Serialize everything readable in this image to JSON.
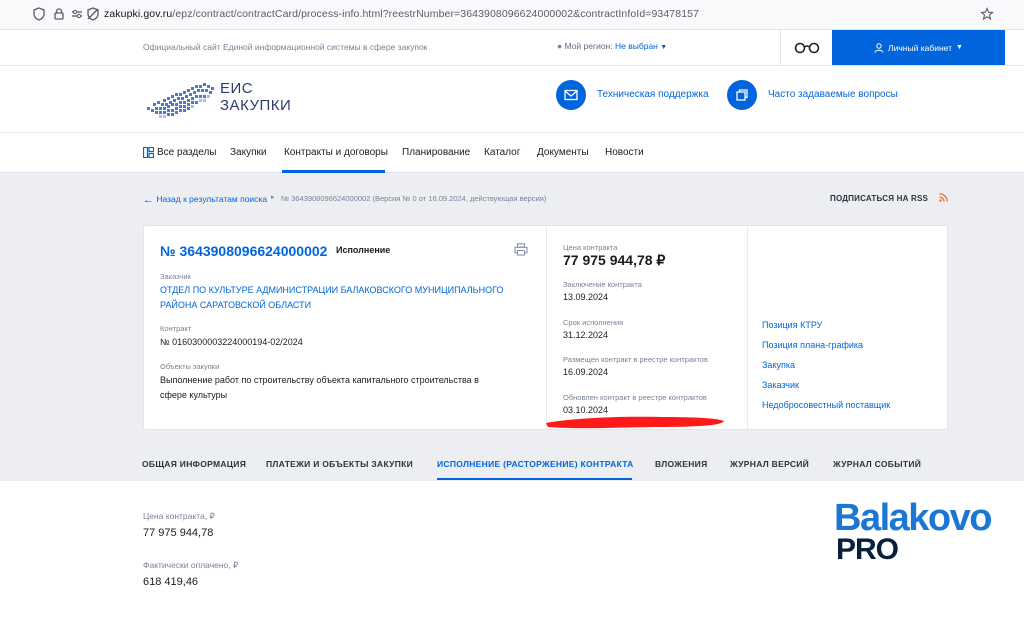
{
  "browser": {
    "url_host": "zakupki.gov.ru",
    "url_path": "/epz/contract/contractCard/process-info.html?reestrNumber=3643908096624000002&contractInfoId=93478157"
  },
  "top": {
    "site_note": "Официальный сайт Единой информационной системы в сфере закупок",
    "region_label": "Мой регион:",
    "region_value": "Не выбран",
    "cabinet_label": "Личный кабинет"
  },
  "header": {
    "logo_line1": "ЕИС",
    "logo_line2": "ЗАКУПКИ",
    "support_label": "Техническая поддержка",
    "faq_label": "Часто задаваемые вопросы"
  },
  "nav": {
    "items": [
      "Все разделы",
      "Закупки",
      "Контракты и договоры",
      "Планирование",
      "Каталог",
      "Документы",
      "Новости"
    ],
    "active": "Контракты и договоры"
  },
  "breadcrumb": {
    "back_label": "Назад к результатам поиска",
    "current": "№ 3643908096624000002 (Версия № 0 от 16.09.2024, действующая версия)",
    "rss_label": "ПОДПИСАТЬСЯ НА RSS"
  },
  "card": {
    "contract_number": "№ 3643908096624000002",
    "status": "Исполнение",
    "customer_label": "Заказчик",
    "customer_line1": "ОТДЕЛ ПО КУЛЬТУРЕ АДМИНИСТРАЦИИ БАЛАКОВСКОГО МУНИЦИПАЛЬНОГО",
    "customer_line2": "РАЙОНА САРАТОВСКОЙ ОБЛАСТИ",
    "contract_label": "Контракт",
    "contract_value": "№ 0160300003224000194-02/2024",
    "objects_label": "Объекты закупки",
    "objects_line1": "Выполнение работ по строительству объекта капитального строительства в",
    "objects_line2": "сфере культуры",
    "price_label": "Цена контракта",
    "price_value": "77 975 944,78 ₽",
    "conclusion_label": "Заключение контракта",
    "conclusion_value": "13.09.2024",
    "deadline_label": "Срок исполнения",
    "deadline_value": "31.12.2024",
    "placed_label": "Размещен контракт в реестре контрактов",
    "placed_value": "16.09.2024",
    "updated_label": "Обновлен контракт в реестре контрактов",
    "updated_value": "03.10.2024",
    "side_links": [
      "Позиция КТРУ",
      "Позиция плана-графика",
      "Закупка",
      "Заказчик",
      "Недобросовестный поставщик"
    ]
  },
  "tabs": {
    "items": [
      "ОБЩАЯ ИНФОРМАЦИЯ",
      "ПЛАТЕЖИ И ОБЪЕКТЫ ЗАКУПКИ",
      "ИСПОЛНЕНИЕ (РАСТОРЖЕНИЕ) КОНТРАКТА",
      "ВЛОЖЕНИЯ",
      "ЖУРНАЛ ВЕРСИЙ",
      "ЖУРНАЛ СОБЫТИЙ"
    ],
    "active": "ИСПОЛНЕНИЕ (РАСТОРЖЕНИЕ) КОНТРАКТА"
  },
  "execution": {
    "price_label": "Цена контракта, ₽",
    "price_value": "77 975 944,78",
    "paid_label": "Фактически оплачено, ₽",
    "paid_value": "618 419,46"
  },
  "watermark": {
    "line1": "Balakovo",
    "line2": "PRO"
  },
  "colors": {
    "accent": "#0065dd",
    "gray_bg": "#eceef1",
    "redaction": "#ff1a1a",
    "rss": "#f26522"
  },
  "icons": {
    "browser": [
      "shield-icon",
      "lock-icon",
      "permissions-icon",
      "tracking-icon",
      "star-icon"
    ],
    "header": [
      "mail-icon",
      "faq-icon",
      "glasses-icon",
      "user-icon"
    ],
    "card": [
      "print-icon"
    ]
  }
}
